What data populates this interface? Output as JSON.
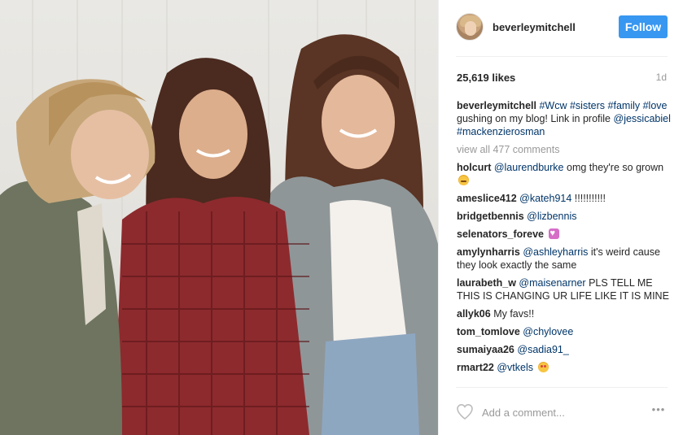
{
  "post": {
    "photo_alt": "three women smiling together",
    "header": {
      "username": "beverleymitchell",
      "follow_label": "Follow",
      "avatar_icon": "profile-avatar"
    },
    "stats": {
      "likes": "25,619 likes",
      "time_ago": "1d"
    },
    "caption": {
      "user": "beverleymitchell",
      "parts": [
        "#Wcw",
        "#sisters",
        "#family",
        "#love",
        "gushing on my blog! Link in profile",
        "@jessicabiel",
        "#mackenzierosman"
      ]
    },
    "view_all": "view all 477 comments",
    "comments": [
      {
        "user": "holcurt",
        "mention": "@laurendburke",
        "text": "omg they're so grown",
        "emoji": "sweat-smile-emoji"
      },
      {
        "user": "ameslice412",
        "mention": "@kateh914",
        "text": "!!!!!!!!!!!",
        "emoji": ""
      },
      {
        "user": "bridgetbennis",
        "mention": "@lizbennis",
        "text": "",
        "emoji": ""
      },
      {
        "user": "selenators_foreve",
        "mention": "",
        "text": "",
        "emoji": "heart-emoji"
      },
      {
        "user": "amylynharris",
        "mention": "@ashleyharris",
        "text": "it's weird cause they look exactly the same",
        "emoji": ""
      },
      {
        "user": "laurabeth_w",
        "mention": "@maisenarner",
        "text": "PLS TELL ME THIS IS CHANGING UR LIFE LIKE IT IS MINE",
        "emoji": ""
      },
      {
        "user": "allyk06",
        "mention": "",
        "text": "My favs!!",
        "emoji": ""
      },
      {
        "user": "tom_tomlove",
        "mention": "@chylovee",
        "text": "",
        "emoji": ""
      },
      {
        "user": "sumaiyaa26",
        "mention": "@sadia91_",
        "text": "",
        "emoji": ""
      },
      {
        "user": "rmart22",
        "mention": "@vtkels",
        "text": "",
        "emoji": "heart-eyes-emoji"
      }
    ],
    "footer": {
      "add_comment_placeholder": "Add a comment...",
      "like_icon": "heart-outline-icon",
      "more_label": "•••"
    }
  },
  "colors": {
    "follow": "#3897f0",
    "link": "#003569",
    "muted": "#999999",
    "text": "#262626"
  }
}
